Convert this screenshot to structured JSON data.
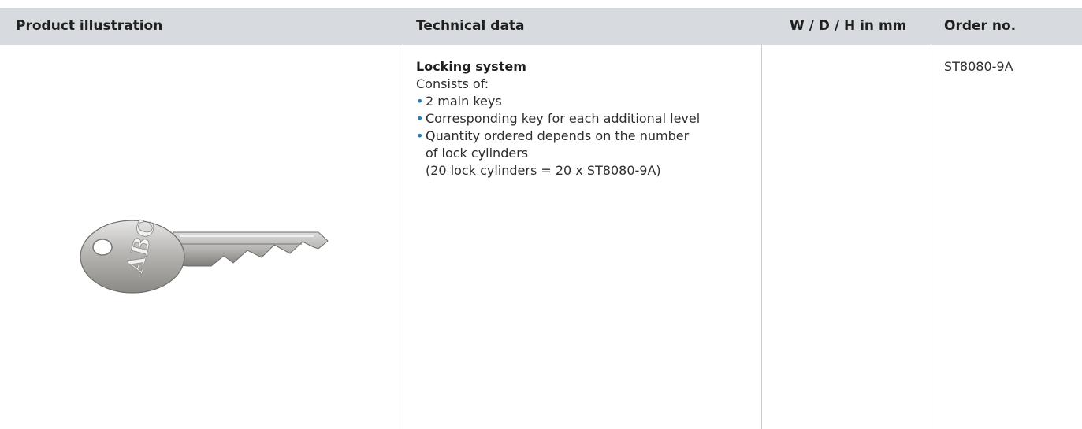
{
  "table": {
    "headers": {
      "illustration": "Product illustration",
      "technical": "Technical data",
      "dimensions": "W / D / H in mm",
      "order": "Order no."
    },
    "row": {
      "key_engraving": "ABC",
      "technical": {
        "title": "Locking system",
        "intro": "Consists of:",
        "items": [
          "2 main keys",
          "Corresponding key for each additional level",
          "Quantity ordered depends on the number",
          "of lock cylinders"
        ],
        "note": "(20 lock cylinders = 20 x ST8080-9A)"
      },
      "dimensions": "",
      "order_no": "ST8080-9A"
    }
  },
  "colors": {
    "header_bg": "#d7dbdf",
    "bullet": "#1a7fc1",
    "divider": "#c9cdd1"
  }
}
